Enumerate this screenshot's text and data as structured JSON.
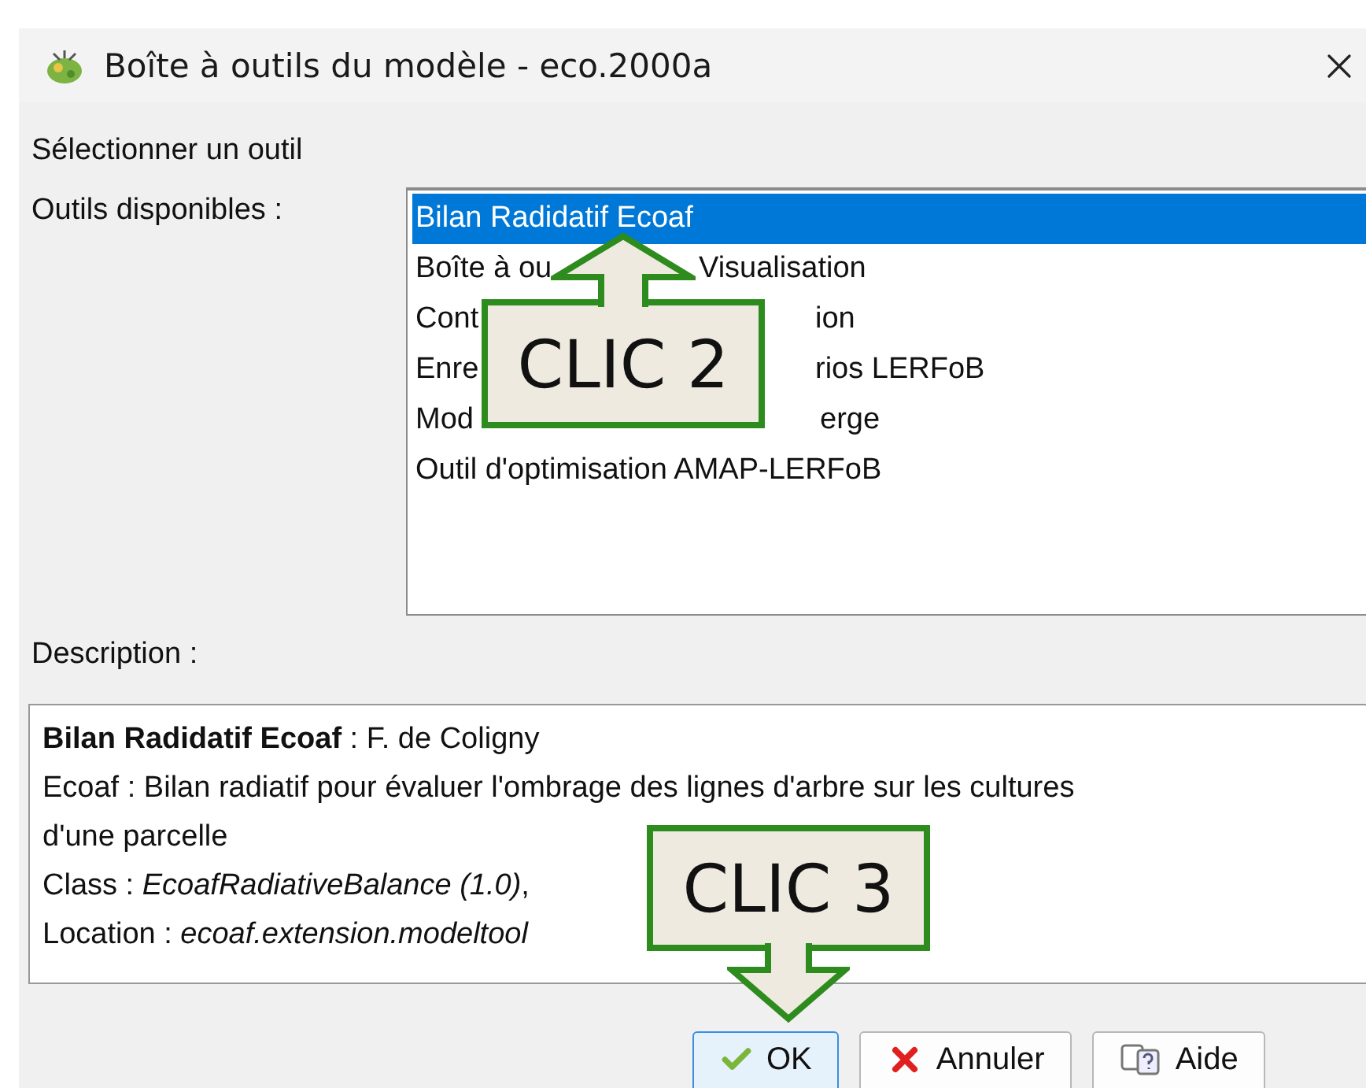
{
  "window": {
    "title": "Boîte à outils du modèle - eco.2000a"
  },
  "heading": "Sélectionner un outil",
  "tools": {
    "label": "Outils disponibles :",
    "items": [
      {
        "parts": [
          "Bilan Radidatif Ecoaf"
        ],
        "selected": true
      },
      {
        "parts": [
          "Boîte à ou",
          "Visualisation"
        ],
        "selected": false
      },
      {
        "parts": [
          "Cont",
          "ion"
        ],
        "selected": false
      },
      {
        "parts": [
          "Enre",
          "rios LERFoB"
        ],
        "selected": false
      },
      {
        "parts": [
          "Mod",
          "erge"
        ],
        "selected": false
      },
      {
        "parts": [
          "Outil d'optimisation AMAP-LERFoB"
        ],
        "selected": false
      }
    ]
  },
  "description": {
    "label": "Description :",
    "lines": [
      "**Bilan Radidatif Ecoaf** : F. de Coligny",
      "Ecoaf : Bilan radiatif pour évaluer l'ombrage des lignes d'arbre sur les cultures",
      "d'une parcelle",
      "Class : *EcoafRadiativeBalance (1.0)*,",
      "Location : *ecoaf.extension.modeltool*"
    ]
  },
  "buttons": [
    {
      "kind": "ok",
      "label": "OK",
      "default": true
    },
    {
      "kind": "cancel",
      "label": "Annuler",
      "default": false
    },
    {
      "kind": "help",
      "label": "Aide",
      "default": false
    }
  ],
  "callouts": [
    {
      "label": "CLIC 2"
    },
    {
      "label": "CLIC 3"
    }
  ]
}
